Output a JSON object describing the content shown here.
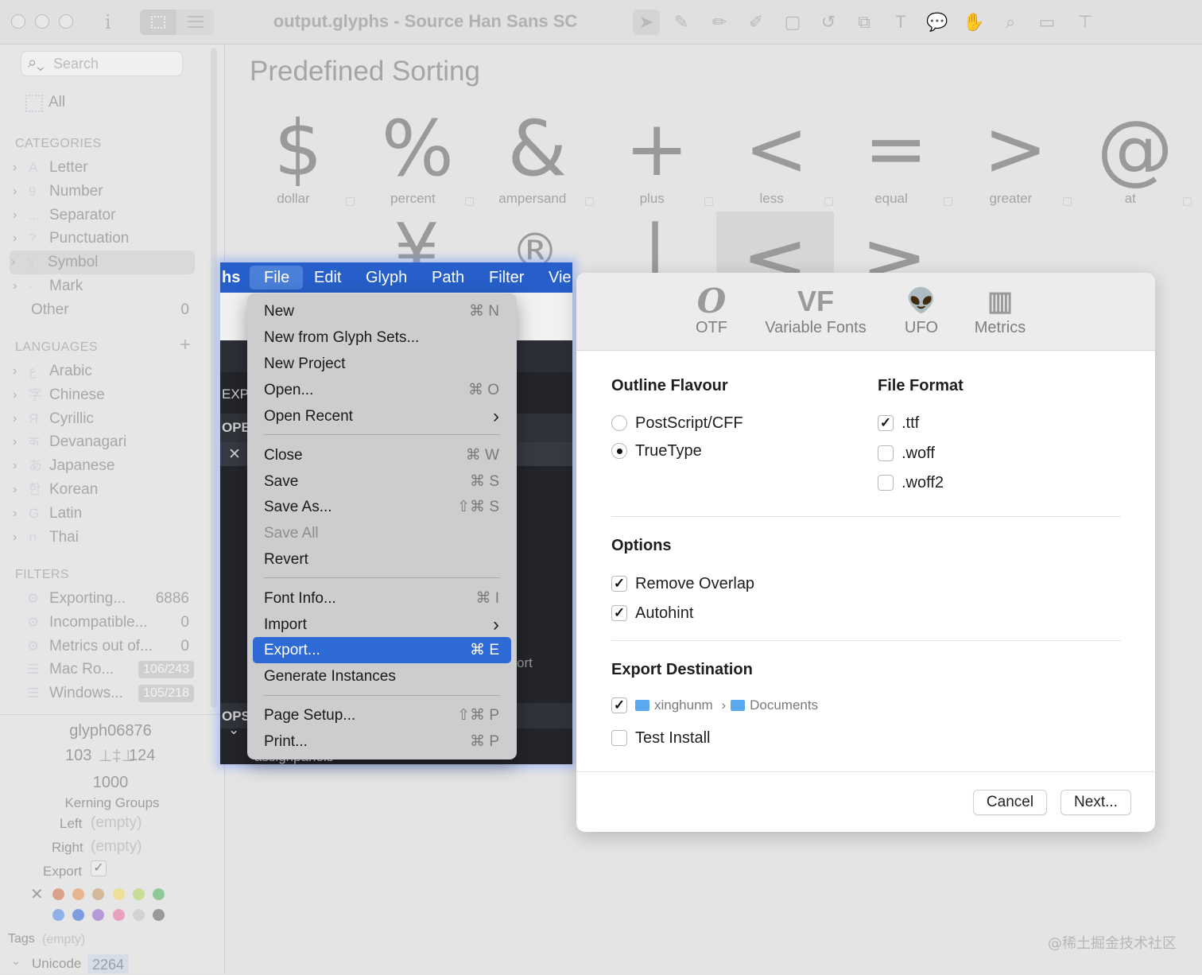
{
  "window": {
    "title": "output.glyphs - Source Han Sans SC"
  },
  "toolbar": {
    "info_icon": "i",
    "tools": [
      "select-tool-icon",
      "draw-tool-icon",
      "pencil-tool-icon",
      "brush-tool-icon",
      "rectangle-tool-icon",
      "rotate-tool-icon",
      "scale-tool-icon",
      "text-tool-icon",
      "annotation-tool-icon",
      "hand-tool-icon",
      "zoom-tool-icon",
      "measure-tool-icon",
      "type-tool-icon"
    ]
  },
  "sidebar": {
    "search_placeholder": "Search",
    "all": "All",
    "categories_header": "CATEGORIES",
    "categories": [
      {
        "label": "Letter",
        "icon": "A"
      },
      {
        "label": "Number",
        "icon": "9"
      },
      {
        "label": "Separator",
        "icon": "..."
      },
      {
        "label": "Punctuation",
        "icon": "?"
      },
      {
        "label": "Symbol",
        "icon": "¶"
      },
      {
        "label": "Mark",
        "icon": "·"
      }
    ],
    "other": {
      "label": "Other",
      "count": "0"
    },
    "languages_header": "LANGUAGES",
    "add": "+",
    "languages": [
      {
        "label": "Arabic",
        "icon": "ع"
      },
      {
        "label": "Chinese",
        "icon": "字"
      },
      {
        "label": "Cyrillic",
        "icon": "Я"
      },
      {
        "label": "Devanagari",
        "icon": "क"
      },
      {
        "label": "Japanese",
        "icon": "あ"
      },
      {
        "label": "Korean",
        "icon": "한"
      },
      {
        "label": "Latin",
        "icon": "G"
      },
      {
        "label": "Thai",
        "icon": "ก"
      }
    ],
    "filters_header": "FILTERS",
    "filters": [
      {
        "label": "Exporting...",
        "count": "6886"
      },
      {
        "label": "Incompatible...",
        "count": "0"
      },
      {
        "label": "Metrics out of...",
        "count": "0"
      },
      {
        "label": "Mac Ro...",
        "badge": "106/243"
      },
      {
        "label": "Windows...",
        "badge": "105/218"
      }
    ]
  },
  "glyph_info": {
    "name": "glyph06876",
    "lsb": "103",
    "rsb": "124",
    "width": "1000",
    "kerning_groups": "Kerning Groups",
    "left_label": "Left",
    "left_value": "(empty)",
    "right_label": "Right",
    "right_value": "(empty)",
    "export_label": "Export",
    "export_check": "✓",
    "tags_label": "Tags",
    "tags_value": "(empty)",
    "unicode_label": "Unicode",
    "unicode_value": "2264",
    "color_clear": "✕",
    "colors_row1": [
      "#d9a08c",
      "#e8b48c",
      "#d4b89a",
      "#ecdf98",
      "#c5dd95",
      "#8fc99a"
    ],
    "colors_row2": [
      "#90b0e8",
      "#7a9ee0",
      "#b49ad8",
      "#e7a0bd",
      "#d2d2d2",
      "#9a9a9a"
    ]
  },
  "main": {
    "title": "Predefined Sorting",
    "glyphs": [
      {
        "char": "$",
        "name": "dollar"
      },
      {
        "char": "%",
        "name": "percent"
      },
      {
        "char": "&",
        "name": "ampersand"
      },
      {
        "char": "+",
        "name": "plus"
      },
      {
        "char": "<",
        "name": "less"
      },
      {
        "char": "=",
        "name": "equal"
      },
      {
        "char": ">",
        "name": "greater"
      },
      {
        "char": "@",
        "name": "at"
      }
    ],
    "row2_glyphs": [
      "¥",
      "®",
      "|",
      "≤",
      "≥"
    ]
  },
  "menubar": {
    "app_fragment": "hs",
    "items": [
      "File",
      "Edit",
      "Glyph",
      "Path",
      "Filter",
      "Vie"
    ]
  },
  "file_menu": {
    "items": [
      {
        "label": "New",
        "shortcut": "⌘ N"
      },
      {
        "label": "New from Glyph Sets...",
        "shortcut": ""
      },
      {
        "label": "New Project",
        "shortcut": ""
      },
      {
        "label": "Open...",
        "shortcut": "⌘ O"
      },
      {
        "label": "Open Recent",
        "shortcut": "›"
      },
      {
        "label": "Close",
        "shortcut": "⌘ W"
      },
      {
        "label": "Save",
        "shortcut": "⌘ S"
      },
      {
        "label": "Save As...",
        "shortcut": "⇧⌘ S"
      },
      {
        "label": "Save All",
        "shortcut": ""
      },
      {
        "label": "Revert",
        "shortcut": ""
      },
      {
        "label": "Font Info...",
        "shortcut": "⌘ I"
      },
      {
        "label": "Import",
        "shortcut": "›"
      },
      {
        "label": "Export...",
        "shortcut": "⌘ E"
      },
      {
        "label": "Generate Instances",
        "shortcut": ""
      },
      {
        "label": "Page Setup...",
        "shortcut": "⇧⌘ P"
      },
      {
        "label": "Print...",
        "shortcut": "⌘ P"
      }
    ],
    "bg_fragments": [
      "EXP",
      "OPE",
      "✕",
      "ort",
      "OPS",
      "⌄",
      "assignpanels"
    ]
  },
  "export_dialog": {
    "tabs": [
      {
        "icon": "O",
        "label": "OTF"
      },
      {
        "icon": "VF",
        "label": "Variable Fonts"
      },
      {
        "icon": "👽",
        "label": "UFO"
      },
      {
        "icon": "▥",
        "label": "Metrics"
      }
    ],
    "outline_flavour": {
      "title": "Outline Flavour",
      "options": [
        "PostScript/CFF",
        "TrueType"
      ],
      "selected": "TrueType"
    },
    "file_format": {
      "title": "File Format",
      "options": [
        ".ttf",
        ".woff",
        ".woff2"
      ],
      "checked": [
        true,
        false,
        false
      ]
    },
    "options": {
      "title": "Options",
      "items": [
        "Remove Overlap",
        "Autohint"
      ],
      "checked": [
        true,
        true
      ]
    },
    "destination": {
      "title": "Export Destination",
      "checked": true,
      "path_user": "xinghunm",
      "path_sep": "›",
      "path_folder": "Documents",
      "test_install": "Test Install",
      "test_install_checked": false
    },
    "cancel": "Cancel",
    "next": "Next..."
  },
  "watermark": "@稀土掘金技术社区"
}
